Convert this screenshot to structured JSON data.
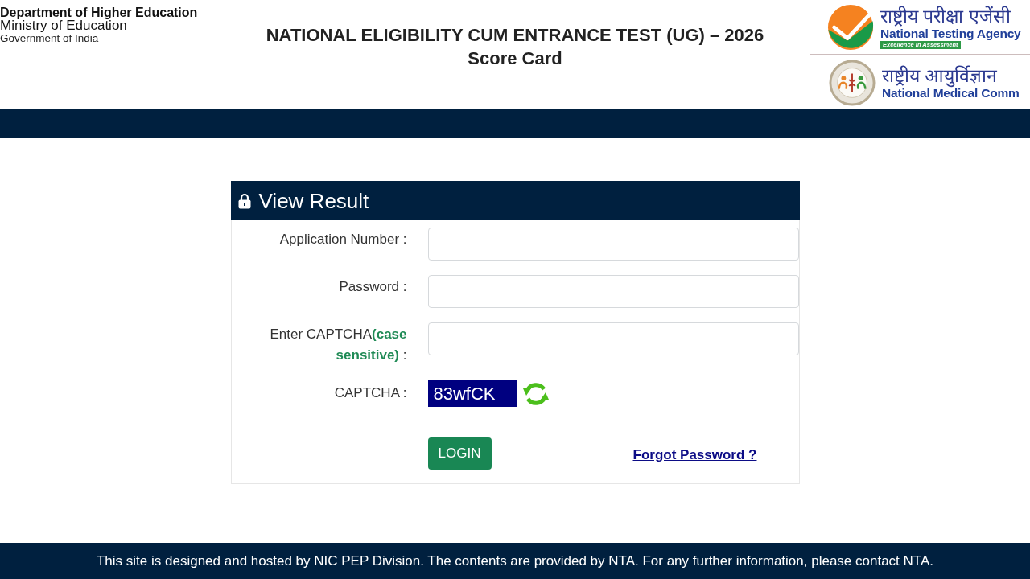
{
  "header": {
    "department": "Department of Higher Education",
    "ministry": "Ministry of Education",
    "government": "Government of India",
    "title": "NATIONAL ELIGIBILITY CUM ENTRANCE TEST (UG) – 2026",
    "subtitle": "Score Card",
    "logos": [
      {
        "kind": "nta",
        "hindi": "राष्ट्रीय परीक्षा एजेंसी",
        "name": "National Testing Agency",
        "tagline": "Excellence in Assessment"
      },
      {
        "kind": "nmc",
        "hindi": "राष्ट्रीय आयुर्विज्ञान",
        "name": "National Medical Comm"
      }
    ]
  },
  "form": {
    "title": "View Result",
    "fields": [
      {
        "kind": "input",
        "label": "Application Number :"
      },
      {
        "kind": "input",
        "label": "Password :"
      },
      {
        "kind": "input",
        "label": "Enter CAPTCHA**(case sensitive)** :"
      },
      {
        "kind": "captcha",
        "label": "CAPTCHA :",
        "code": "83wfCK"
      }
    ],
    "login_button": "LOGIN",
    "forgot_link": "Forgot Password ?"
  },
  "footer": "This site is designed and hosted by NIC PEP Division. The contents are provided by NTA. For any further information, please contact NTA."
}
